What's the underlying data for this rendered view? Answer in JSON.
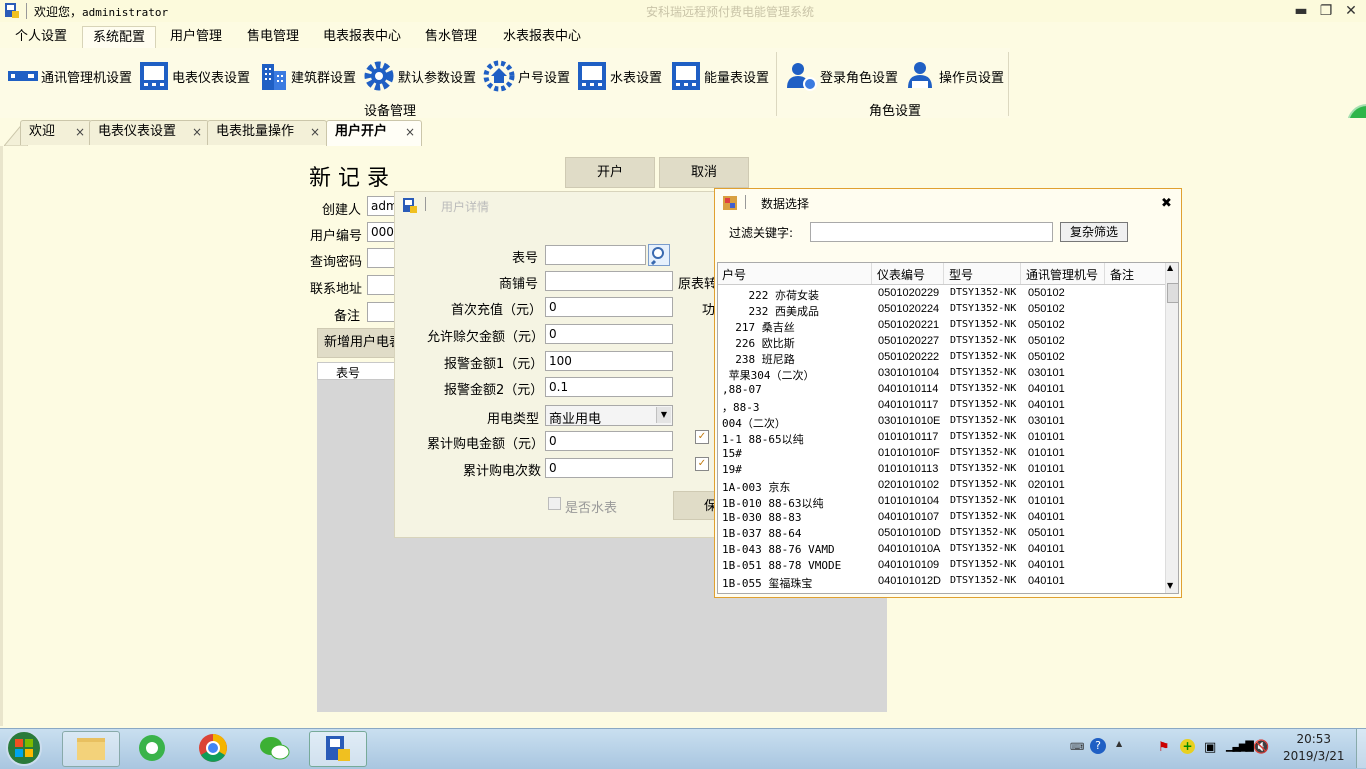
{
  "titlebar": {
    "welcome_cn": "欢迎您，",
    "welcome_user": "administrator",
    "title": "安科瑞远程预付费电能管理系统",
    "minimize": "▬",
    "restore": "❐",
    "close": "✕"
  },
  "menu": {
    "tabs": [
      "个人设置",
      "系统配置",
      "用户管理",
      "售电管理",
      "电表报表中心",
      "售水管理",
      "水表报表中心"
    ],
    "active": "系统配置"
  },
  "ribbon": {
    "device_buttons": [
      "通讯管理机设置",
      "电表仪表设置",
      "建筑群设置",
      "默认参数设置",
      "户号设置",
      "水表设置",
      "能量表设置"
    ],
    "device_group": "设备管理",
    "role_buttons": [
      "登录角色设置",
      "操作员设置"
    ],
    "role_group": "角色设置",
    "side_badge": "48"
  },
  "doctabs": [
    {
      "label": "欢迎",
      "close": "×"
    },
    {
      "label": "电表仪表设置",
      "close": "×"
    },
    {
      "label": "电表批量操作",
      "close": "×"
    },
    {
      "label": "用户开户",
      "close": "×"
    }
  ],
  "form": {
    "heading": "新 记 录",
    "open_button": "开户",
    "cancel_button": "取消",
    "creator_label": "创建人",
    "creator_value": "admin",
    "userno_label": "用户编号",
    "userno_value": "0000",
    "password_label": "查询密码",
    "address_label": "联系地址",
    "remark_label": "备注",
    "add_meter_button": "新增用户电表",
    "table_header": "表号"
  },
  "detail_dialog": {
    "title": "用户详情",
    "meter_no_label": "表号",
    "shop_no_label": "商铺号",
    "old_meter_label": "原表转",
    "first_charge_label": "首次充值（元）",
    "first_charge_value": "0",
    "power_label": "功",
    "credit_label": "允许赊欠金额（元）",
    "credit_value": "0",
    "alarm1_label": "报警金额1（元）",
    "alarm1_value": "100",
    "alarm2_label": "报警金额2（元）",
    "alarm2_value": "0.1",
    "power_type_label": "用电类型",
    "power_type_value": "商业用电",
    "total_amount_label": "累计购电金额（元）",
    "total_amount_value": "0",
    "total_count_label": "累计购电次数",
    "total_count_value": "0",
    "water_meter_label": "是否水表",
    "save_button": "保"
  },
  "select_dialog": {
    "title": "数据选择",
    "close": "✖",
    "filter_label": "过滤关键字:",
    "filter_value": "",
    "complex_filter_button": "复杂筛选",
    "columns": [
      "户号",
      "仪表编号",
      "型号",
      "通讯管理机号",
      "备注"
    ],
    "rows": [
      [
        "    222 亦荷女装",
        "0501020229",
        "DTSY1352-NK",
        "050102"
      ],
      [
        "    232 西美成品",
        "0501020224",
        "DTSY1352-NK",
        "050102"
      ],
      [
        "  217 桑吉丝",
        "0501020221",
        "DTSY1352-NK",
        "050102"
      ],
      [
        "  226 欧比斯",
        "0501020227",
        "DTSY1352-NK",
        "050102"
      ],
      [
        "  238 班尼路",
        "0501020222",
        "DTSY1352-NK",
        "050102"
      ],
      [
        " 苹果304（二次）",
        "0301010104",
        "DTSY1352-NK",
        "030101"
      ],
      [
        ",88-07",
        "0401010114",
        "DTSY1352-NK",
        "040101"
      ],
      [
        "，88-3",
        "0401010117",
        "DTSY1352-NK",
        "040101"
      ],
      [
        "004（二次）",
        "030101010E",
        "DTSY1352-NK",
        "030101"
      ],
      [
        "1-1 88-65以纯",
        "0101010117",
        "DTSY1352-NK",
        "010101"
      ],
      [
        "15#",
        "010101010F",
        "DTSY1352-NK",
        "010101"
      ],
      [
        "19#",
        "0101010113",
        "DTSY1352-NK",
        "010101"
      ],
      [
        "1A-003 京东",
        "0201010102",
        "DTSY1352-NK",
        "020101"
      ],
      [
        "1B-010 88-63以纯",
        "0101010104",
        "DTSY1352-NK",
        "010101"
      ],
      [
        "1B-030 88-83",
        "0401010107",
        "DTSY1352-NK",
        "040101"
      ],
      [
        "1B-037 88-64",
        "050101010D",
        "DTSY1352-NK",
        "050101"
      ],
      [
        "1B-043 88-76 VAMD",
        "040101010A",
        "DTSY1352-NK",
        "040101"
      ],
      [
        "1B-051 88-78 VMODE",
        "0401010109",
        "DTSY1352-NK",
        "040101"
      ],
      [
        "1B-055 玺福珠宝",
        "040101012D",
        "DTSY1352-NK",
        "040101"
      ]
    ]
  },
  "taskbar": {
    "time": "20:53",
    "date": "2019/3/21"
  }
}
